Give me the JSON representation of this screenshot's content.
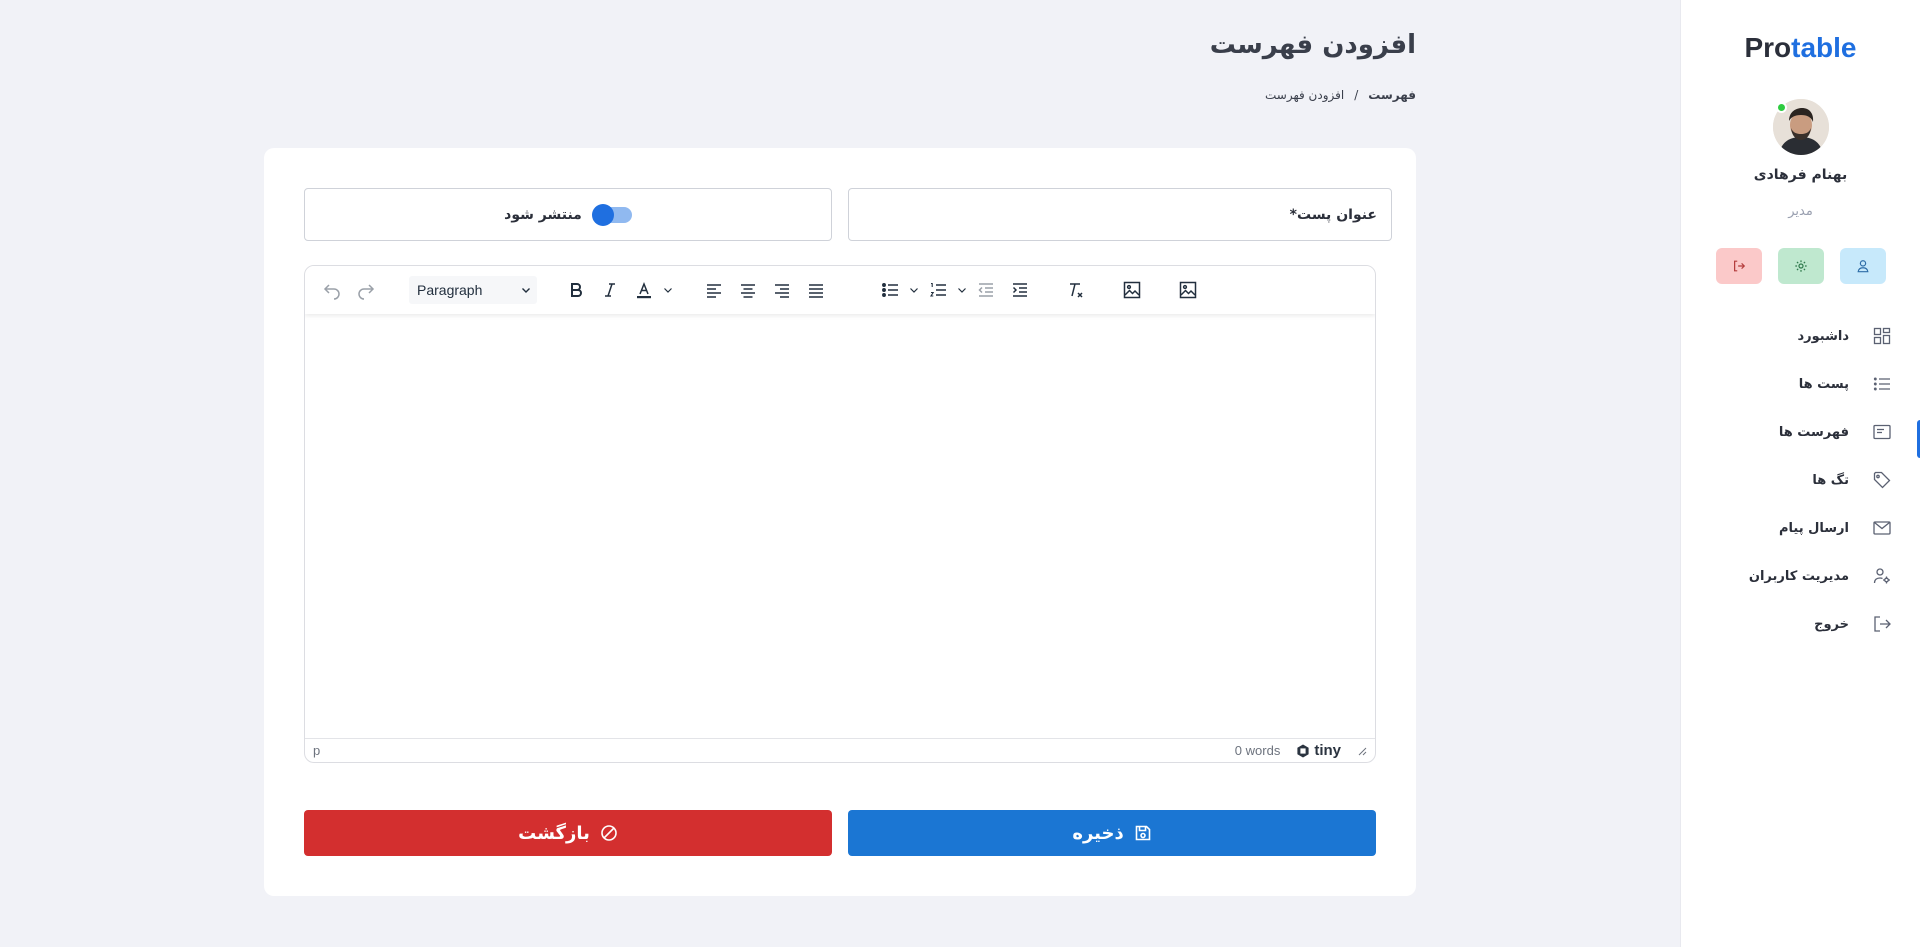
{
  "sidebar": {
    "logo_pre": "Pro",
    "logo_accent": "table",
    "user_name": "بهنام فرهادی",
    "user_role": "مدیر",
    "items": [
      {
        "label": "داشبورد",
        "icon": "dashboard-icon"
      },
      {
        "label": "پست ها",
        "icon": "list-icon"
      },
      {
        "label": "فهرست ها",
        "icon": "catalog-icon",
        "active": true
      },
      {
        "label": "تگ ها",
        "icon": "tag-icon"
      },
      {
        "label": "ارسال پیام",
        "icon": "mail-icon"
      },
      {
        "label": "مدیریت کاربران",
        "icon": "user-settings-icon"
      },
      {
        "label": "خروج",
        "icon": "logout-icon"
      }
    ]
  },
  "header": {
    "title": "افزودن فهرست",
    "breadcrumb": [
      "فهرست",
      "/",
      "افزودن فهرست"
    ]
  },
  "form": {
    "title_placeholder": "عنوان پست*",
    "publish_label": "منتشر شود",
    "publish_on": true
  },
  "editor": {
    "block_format": "Paragraph",
    "status_path": "p",
    "word_count": "0 words",
    "brand": "tiny"
  },
  "actions": {
    "save_label": "ذخیره",
    "back_label": "بازگشت"
  },
  "colors": {
    "accent": "#1f6fe0",
    "save": "#1b76d3",
    "back": "#d32f2f"
  }
}
